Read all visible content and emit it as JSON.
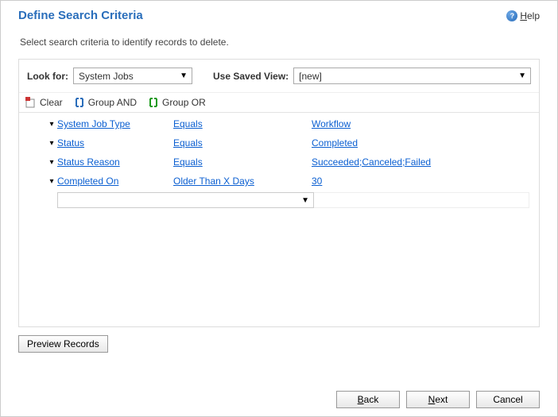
{
  "header": {
    "title": "Define Search Criteria",
    "help_label": "Help"
  },
  "subtext": "Select search criteria to identify records to delete.",
  "lookfor": {
    "label": "Look for:",
    "value": "System Jobs"
  },
  "view": {
    "label": "Use Saved View:",
    "value": "[new]"
  },
  "toolbar": {
    "clear": "Clear",
    "group_and": "Group AND",
    "group_or": "Group OR"
  },
  "rows": [
    {
      "field": "System Job Type",
      "op": "Equals",
      "val": "Workflow"
    },
    {
      "field": "Status",
      "op": "Equals",
      "val": "Completed"
    },
    {
      "field": "Status Reason",
      "op": "Equals",
      "val": "Succeeded;Canceled;Failed"
    },
    {
      "field": "Completed On",
      "op": "Older Than X Days",
      "val": "30"
    }
  ],
  "buttons": {
    "preview": "Preview Records",
    "back": "Back",
    "next": "Next",
    "cancel": "Cancel"
  }
}
